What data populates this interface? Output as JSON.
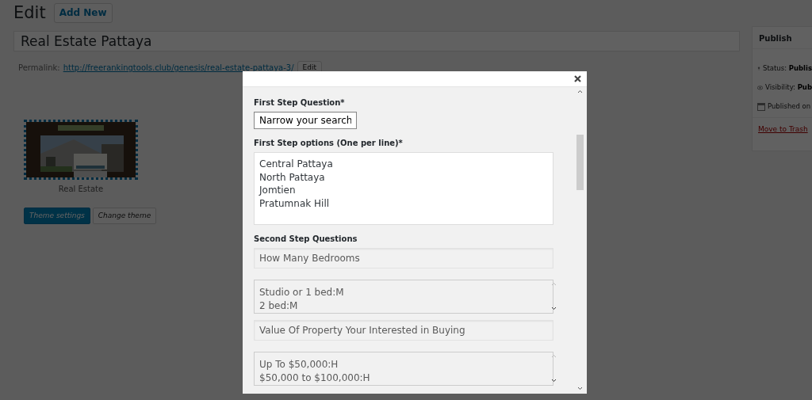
{
  "page": {
    "heading": "Edit",
    "add_new_button": "Add New",
    "title_value": "Real Estate Pattaya",
    "permalink": {
      "label": "Permalink:",
      "url": "http://freerankingtools.club/genesis/real-estate-pattaya-3/",
      "edit_button": "Edit"
    },
    "theme": {
      "name": "Real Estate",
      "buttons": [
        {
          "label": "Theme settings",
          "primary": true
        },
        {
          "label": "Change theme",
          "primary": false
        }
      ]
    }
  },
  "publish_box": {
    "title": "Publish",
    "rows": [
      {
        "kind": "status",
        "text": "Status: **Publis**"
      },
      {
        "kind": "visibility",
        "text": "Visibility: **Pub**"
      },
      {
        "kind": "date",
        "text": "Published on"
      }
    ],
    "trash_link": "Move to Trash"
  },
  "modal": {
    "sections": [
      {
        "label": "First Step Question*",
        "fields": [
          {
            "kind": "input",
            "disabled": false,
            "value": "Narrow your search"
          }
        ]
      },
      {
        "label": "First Step options (One per line)*",
        "fields": [
          {
            "kind": "textarea",
            "disabled": false,
            "lines": [
              "Central Pattaya",
              "North Pattaya",
              "Jomtien",
              "Pratumnak Hill"
            ]
          }
        ]
      },
      {
        "label": "Second Step Questions",
        "fields": [
          {
            "kind": "input",
            "disabled": true,
            "value": "How Many Bedrooms"
          },
          {
            "kind": "textarea",
            "disabled": true,
            "lines": [
              "Studio or 1 bed:M",
              "2 bed:M"
            ]
          },
          {
            "kind": "input",
            "disabled": true,
            "value": "Value Of Property Your Interested in Buying"
          },
          {
            "kind": "textarea",
            "disabled": true,
            "lines": [
              "Up To $50,000:H",
              "$50,000 to $100,000:H"
            ]
          }
        ]
      }
    ]
  }
}
